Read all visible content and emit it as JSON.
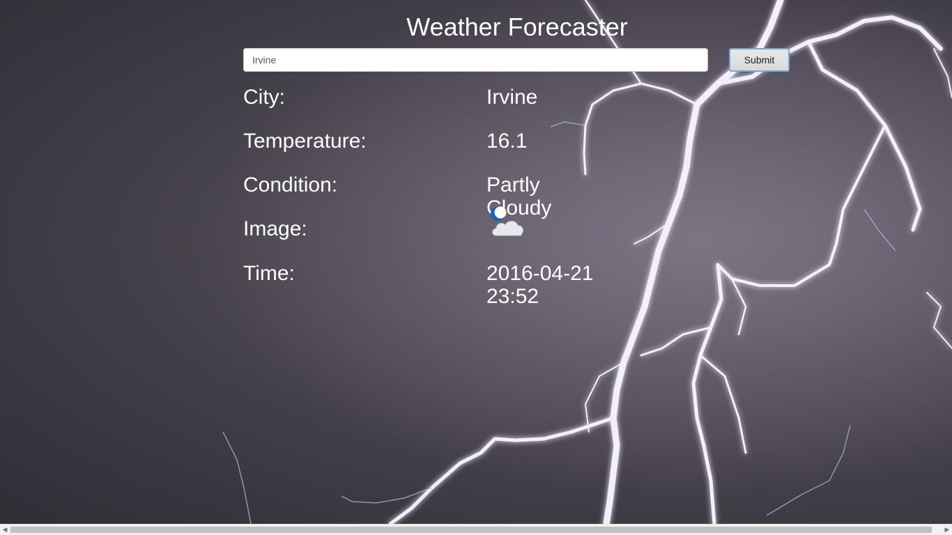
{
  "header": {
    "title": "Weather Forecaster"
  },
  "search": {
    "value": "Irvine",
    "submit_label": "Submit"
  },
  "details": {
    "city_label": "City:",
    "city_value": "Irvine",
    "temperature_label": "Temperature:",
    "temperature_value": "16.1",
    "condition_label": "Condition:",
    "condition_value": "Partly Cloudy",
    "image_label": "Image:",
    "image_icon": "partly-cloudy-night-icon",
    "time_label": "Time:",
    "time_value": "2016-04-21 23:52"
  },
  "scrollbar": {
    "left_arrow": "◀",
    "right_arrow": "▶"
  },
  "colors": {
    "text": "#ffffff",
    "moon": "#1565c0",
    "cloud": "#e8e8ec",
    "button_border": "#7aa3e0"
  }
}
